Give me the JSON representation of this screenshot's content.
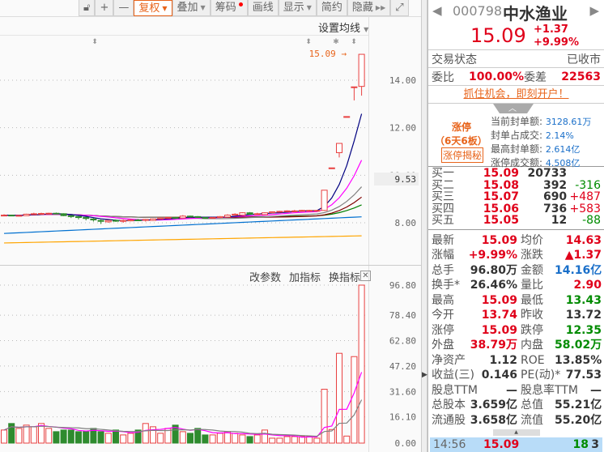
{
  "toolbar": {
    "lock": "lock-icon",
    "zoom_in": "+",
    "zoom_out": "—",
    "fuquan": "复权",
    "overlay": "叠加",
    "chips": "筹码",
    "draw": "画线",
    "display": "显示",
    "simple": "简约",
    "hide": "隐藏",
    "expand": "expand-icon"
  },
  "main_chart": {
    "ma_setting": "设置均线",
    "price_ticks": [
      "14.00",
      "12.00",
      "10.00",
      "8.00"
    ],
    "cursor_price": "9.53",
    "last_price_label": "15.09"
  },
  "volume_chart": {
    "buttons": [
      "改参数",
      "加指标",
      "换指标"
    ],
    "ticks": [
      "96.80",
      "78.40",
      "62.80",
      "47.20",
      "31.60",
      "16.10",
      "0.00"
    ]
  },
  "colors": {
    "up": "#e84040",
    "down": "#2e8b2e",
    "ma5": "#000080",
    "ma10": "#ff00ff",
    "ma20": "#808080",
    "ma30": "#800000",
    "ma60": "#008000",
    "ma120": "#0070d0",
    "ma250": "#ffa500"
  },
  "chart_data": {
    "type": "candlestick",
    "ylim": [
      6.3,
      16.5
    ],
    "candles": [
      [
        8.3,
        8.32,
        8.36,
        8.28
      ],
      [
        8.32,
        8.3,
        8.34,
        8.28
      ],
      [
        8.3,
        8.31,
        8.33,
        8.28
      ],
      [
        8.3,
        8.36,
        8.38,
        8.29
      ],
      [
        8.36,
        8.38,
        8.42,
        8.34
      ],
      [
        8.38,
        8.39,
        8.42,
        8.36
      ],
      [
        8.39,
        8.4,
        8.42,
        8.37
      ],
      [
        8.4,
        8.38,
        8.43,
        8.36
      ],
      [
        8.38,
        8.3,
        8.4,
        8.28
      ],
      [
        8.3,
        8.26,
        8.32,
        8.2
      ],
      [
        8.26,
        8.22,
        8.28,
        8.14
      ],
      [
        8.22,
        8.18,
        8.25,
        8.1
      ],
      [
        8.16,
        8.12,
        8.2,
        8.05
      ],
      [
        8.1,
        8.06,
        8.14,
        7.95
      ],
      [
        8.04,
        8.1,
        8.12,
        8.0
      ],
      [
        8.1,
        8.08,
        8.14,
        8.04
      ],
      [
        8.06,
        8.1,
        8.14,
        8.0
      ],
      [
        8.08,
        8.12,
        8.15,
        8.06
      ],
      [
        8.12,
        8.1,
        8.16,
        8.08
      ],
      [
        8.1,
        8.14,
        8.16,
        8.05
      ],
      [
        8.1,
        8.16,
        8.18,
        8.08
      ],
      [
        8.16,
        8.2,
        8.22,
        8.14
      ],
      [
        8.2,
        8.22,
        8.24,
        8.18
      ],
      [
        8.22,
        8.2,
        8.25,
        8.18
      ],
      [
        8.2,
        8.28,
        8.32,
        8.19
      ],
      [
        8.28,
        8.26,
        8.3,
        8.22
      ],
      [
        8.26,
        8.22,
        8.28,
        8.2
      ],
      [
        8.22,
        8.2,
        8.24,
        8.18
      ],
      [
        8.2,
        8.22,
        8.24,
        8.18
      ],
      [
        8.22,
        8.26,
        8.28,
        8.2
      ],
      [
        8.24,
        8.32,
        8.36,
        8.22
      ],
      [
        8.32,
        8.36,
        8.4,
        8.3
      ],
      [
        8.32,
        8.42,
        8.44,
        8.3
      ],
      [
        8.42,
        8.36,
        8.45,
        8.34
      ],
      [
        8.36,
        8.38,
        8.42,
        8.34
      ],
      [
        8.34,
        8.42,
        8.44,
        8.32
      ],
      [
        8.42,
        8.46,
        8.48,
        8.4
      ],
      [
        8.46,
        8.48,
        8.5,
        8.44
      ],
      [
        8.48,
        8.5,
        8.52,
        8.46
      ],
      [
        8.5,
        8.5,
        8.54,
        8.48
      ],
      [
        8.5,
        8.52,
        8.54,
        8.48
      ],
      [
        8.52,
        8.52,
        8.54,
        8.5
      ],
      [
        8.5,
        8.52,
        8.54,
        8.48
      ],
      [
        8.52,
        9.37,
        9.37,
        8.5
      ],
      [
        10.31,
        10.31,
        10.31,
        10.31
      ],
      [
        10.95,
        11.34,
        11.34,
        10.75
      ],
      [
        12.47,
        12.47,
        12.47,
        12.47
      ],
      [
        13.72,
        13.72,
        13.72,
        13.15
      ],
      [
        13.74,
        15.09,
        15.09,
        13.35
      ]
    ],
    "ma120_range": [
      7.55,
      8.25
    ],
    "ma250_range": [
      7.15,
      7.45
    ],
    "volumes": [
      8,
      12,
      9,
      11,
      10,
      12,
      9,
      7,
      8,
      8,
      7,
      7,
      9,
      7,
      6,
      8,
      5,
      6,
      8,
      12,
      10,
      6,
      9,
      11,
      7,
      6,
      9,
      5,
      5,
      6,
      7,
      6,
      5,
      4,
      5,
      8,
      3,
      3,
      4,
      4,
      4,
      4,
      3,
      33,
      8.3,
      55,
      4.3,
      53,
      96.8
    ],
    "volume_ylim": [
      0,
      96.8
    ]
  },
  "quote": {
    "code": "000798",
    "name": "中水渔业",
    "price": "15.09",
    "change": "+1.37",
    "pct": "+9.99%",
    "status_label": "交易状态",
    "status": "已收市",
    "weibi_label": "委比",
    "weibi": "100.00%",
    "weicha_label": "委差",
    "weicha": "22563",
    "promo": "抓住机会，即刻开户！",
    "limit": {
      "title": "涨停",
      "days": "（6天6板）",
      "secret": "涨停揭秘",
      "items": [
        {
          "label": "当前封单额:",
          "value": "3128.61万"
        },
        {
          "label": "封单占成交:",
          "value": "2.14%"
        },
        {
          "label": "最高封单额:",
          "value": "2.614亿"
        },
        {
          "label": "涨停成交额:",
          "value": "4.508亿"
        }
      ]
    },
    "bids": [
      {
        "label": "买一",
        "price": "15.09",
        "vol": "20733",
        "chg": ""
      },
      {
        "label": "买二",
        "price": "15.08",
        "vol": "392",
        "chg": "-316"
      },
      {
        "label": "买三",
        "price": "15.07",
        "vol": "690",
        "chg": "+487"
      },
      {
        "label": "买四",
        "price": "15.06",
        "vol": "736",
        "chg": "+583"
      },
      {
        "label": "买五",
        "price": "15.05",
        "vol": "12",
        "chg": "-88"
      }
    ],
    "stats": [
      [
        "最新",
        "15.09",
        "均价",
        "14.63"
      ],
      [
        "涨幅",
        "+9.99%",
        "涨跌",
        "▲1.37"
      ],
      [
        "总手",
        "96.80万",
        "金额",
        "14.16亿"
      ],
      [
        "换手*",
        "26.46%",
        "量比",
        "2.90"
      ],
      [
        "最高",
        "15.09",
        "最低",
        "13.43"
      ],
      [
        "今开",
        "13.74",
        "昨收",
        "13.72"
      ],
      [
        "涨停",
        "15.09",
        "跌停",
        "12.35"
      ],
      [
        "外盘",
        "38.79万",
        "内盘",
        "58.02万"
      ],
      [
        "净资产",
        "1.12",
        "ROE",
        "13.85%"
      ],
      [
        "收益(三)",
        "0.146",
        "PE(动)*",
        "77.53"
      ],
      [
        "股息TTM",
        "—",
        "股息率TTM",
        "—"
      ],
      [
        "总股本",
        "3.659亿",
        "总值",
        "55.21亿"
      ],
      [
        "流通股",
        "3.658亿",
        "流值",
        "55.20亿"
      ]
    ],
    "tick": {
      "time": "14:56",
      "price": "15.09",
      "vol": "18",
      "count": "3"
    }
  }
}
